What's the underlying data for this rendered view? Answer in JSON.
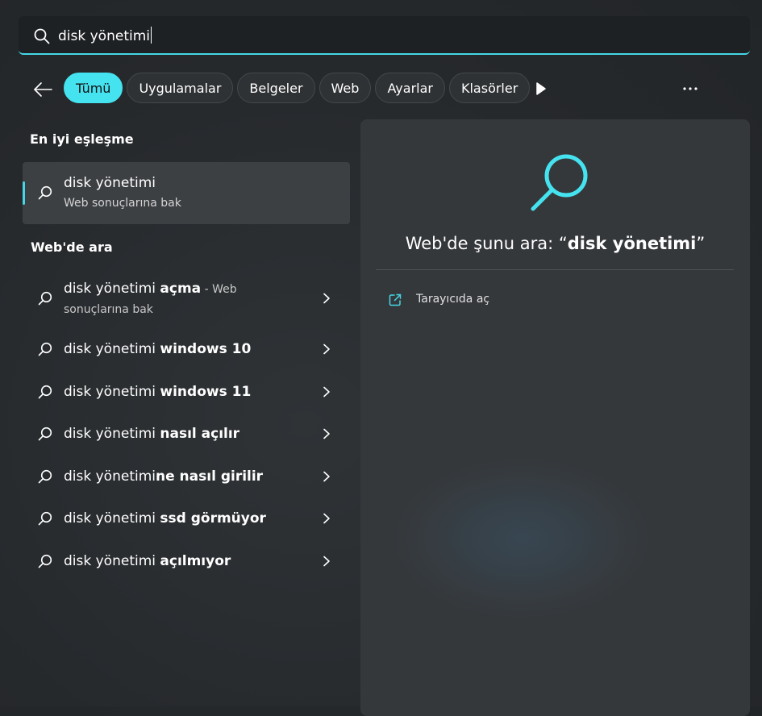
{
  "search": {
    "query": "disk yönetimi"
  },
  "filters": [
    "Tümü",
    "Uygulamalar",
    "Belgeler",
    "Web",
    "Ayarlar",
    "Klasörler"
  ],
  "sections": {
    "best_match": "En iyi eşleşme",
    "web_search": "Web'de ara"
  },
  "best_match": {
    "title": "disk yönetimi",
    "subtitle": "Web sonuçlarına bak"
  },
  "web_results": [
    {
      "prefix": "disk yönetimi ",
      "bold": "açma",
      "hint": " - Web",
      "line2": "sonuçlarına bak"
    },
    {
      "prefix": "disk yönetimi ",
      "bold": "windows 10"
    },
    {
      "prefix": "disk yönetimi ",
      "bold": "windows 11"
    },
    {
      "prefix": "disk yönetimi ",
      "bold": "nasıl açılır"
    },
    {
      "prefix": "disk yönetimi",
      "bold": "ne nasıl girilir"
    },
    {
      "prefix": "disk yönetimi ",
      "bold": "ssd görmüyor"
    },
    {
      "prefix": "disk yönetimi ",
      "bold": "açılmıyor"
    }
  ],
  "preview": {
    "title_prefix": "Web'de şunu ara: “",
    "title_query": "disk yönetimi",
    "title_suffix": "”",
    "open_in_browser": "Tarayıcıda aç"
  },
  "colors": {
    "accent": "#45e3f0",
    "panel": "#35383b",
    "highlight": "#3d4043"
  }
}
